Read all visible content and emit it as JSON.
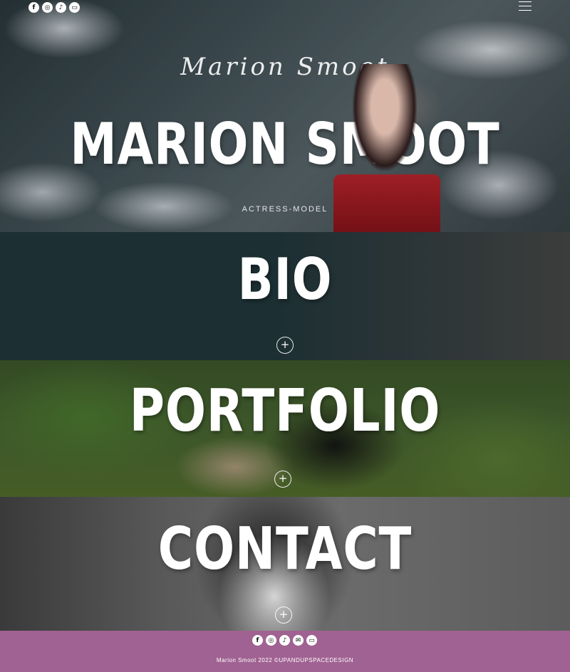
{
  "hero": {
    "script_logo": "Marion Smoot",
    "title": "MARION SMOOT",
    "tagline": "ACTRESS-MODEL"
  },
  "sections": {
    "bio": {
      "title": "BIO",
      "expand_label": "+"
    },
    "portfolio": {
      "title": "PORTFOLIO",
      "expand_label": "+"
    },
    "contact": {
      "title": "CONTACT",
      "expand_label": "+"
    }
  },
  "social_icons": {
    "facebook": "f",
    "instagram": "◎",
    "tiktok": "♪",
    "email": "✉",
    "imdb": "▭"
  },
  "footer": {
    "copyright": "Marion Smoot 2022 ©UPANDUPSPACEDESIGN",
    "background": "#a06292"
  }
}
